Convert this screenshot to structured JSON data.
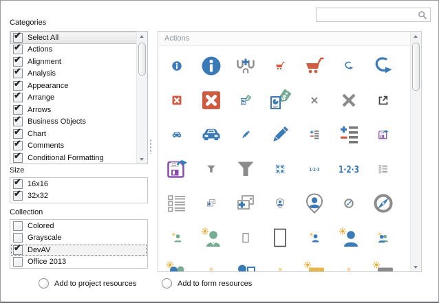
{
  "search": {
    "value": "",
    "placeholder": ""
  },
  "categories": {
    "label": "Categories",
    "items": [
      {
        "label": "Select All",
        "checked": true,
        "selected": true
      },
      {
        "label": "Actions",
        "checked": true
      },
      {
        "label": "Alignment",
        "checked": true
      },
      {
        "label": "Analysis",
        "checked": true
      },
      {
        "label": "Appearance",
        "checked": true
      },
      {
        "label": "Arrange",
        "checked": true
      },
      {
        "label": "Arrows",
        "checked": true
      },
      {
        "label": "Business Objects",
        "checked": true
      },
      {
        "label": "Chart",
        "checked": true
      },
      {
        "label": "Comments",
        "checked": true
      },
      {
        "label": "Conditional Formatting",
        "checked": true
      }
    ]
  },
  "size": {
    "label": "Size",
    "items": [
      {
        "label": "16x16",
        "checked": true
      },
      {
        "label": "32x32",
        "checked": true
      }
    ]
  },
  "collection": {
    "label": "Collection",
    "items": [
      {
        "label": "Colored",
        "checked": false
      },
      {
        "label": "Grayscale",
        "checked": false
      },
      {
        "label": "DevAV",
        "checked": true,
        "focused": true
      },
      {
        "label": "Office 2013",
        "checked": false
      }
    ]
  },
  "icon_panel": {
    "header": "Actions",
    "icons": [
      {
        "name": "info",
        "size": 16
      },
      {
        "name": "info",
        "size": 32
      },
      {
        "name": "insert-between",
        "size": 32
      },
      {
        "name": "shopping-cart",
        "size": 16
      },
      {
        "name": "shopping-cart",
        "size": 32
      },
      {
        "name": "redo-arrow",
        "size": 16
      },
      {
        "name": "redo-arrow",
        "size": 32
      },
      {
        "name": "delete",
        "size": 16
      },
      {
        "name": "delete",
        "size": 32
      },
      {
        "name": "price-tag",
        "size": 16
      },
      {
        "name": "price-tag",
        "size": 32
      },
      {
        "name": "close",
        "size": 16
      },
      {
        "name": "close",
        "size": 32
      },
      {
        "name": "open-external",
        "size": 16
      },
      {
        "name": "car",
        "size": 16
      },
      {
        "name": "car",
        "size": 32
      },
      {
        "name": "edit-pencil",
        "size": 16
      },
      {
        "name": "edit-pencil",
        "size": 32
      },
      {
        "name": "add-remove-items",
        "size": 16
      },
      {
        "name": "add-remove-items",
        "size": 32
      },
      {
        "name": "save-export",
        "size": 16
      },
      {
        "name": "save-export",
        "size": 32
      },
      {
        "name": "filter",
        "size": 16
      },
      {
        "name": "filter",
        "size": 32
      },
      {
        "name": "expand",
        "size": 16
      },
      {
        "name": "numbering",
        "size": 16
      },
      {
        "name": "numbering",
        "size": 32
      },
      {
        "name": "item-list",
        "size": 16
      },
      {
        "name": "item-list",
        "size": 32
      },
      {
        "name": "add-cards",
        "size": 16
      },
      {
        "name": "add-cards",
        "size": 32
      },
      {
        "name": "person-pin",
        "size": 16
      },
      {
        "name": "person-pin",
        "size": 32
      },
      {
        "name": "compass",
        "size": 16
      },
      {
        "name": "compass",
        "size": 32
      },
      {
        "name": "new-employee-green",
        "size": 16
      },
      {
        "name": "new-employee-green",
        "size": 32
      },
      {
        "name": "blank-form",
        "size": 16
      },
      {
        "name": "blank-form",
        "size": 32
      },
      {
        "name": "new-employee-blue",
        "size": 16
      },
      {
        "name": "new-employee-blue",
        "size": 32
      },
      {
        "name": "new-team",
        "size": 16
      },
      {
        "name": "new-team",
        "size": 32
      },
      {
        "name": "sparkle",
        "size": 16
      },
      {
        "name": "id-card-person",
        "size": 32
      },
      {
        "name": "sparkle",
        "size": 16
      },
      {
        "name": "new-badge-yellow",
        "size": 32
      },
      {
        "name": "sparkle",
        "size": 16
      },
      {
        "name": "new-badge-gray",
        "size": 32
      }
    ]
  },
  "footer": {
    "options": [
      {
        "label": "Add to project resources",
        "selected": false
      },
      {
        "label": "Add to form resources",
        "selected": false
      }
    ]
  },
  "colors": {
    "blue": "#3a7ab7",
    "red": "#cf5b40",
    "green": "#76ac92",
    "purple": "#8d4fae",
    "gray": "#8b8b8b",
    "dark": "#3f4042",
    "yellow": "#ecaa31"
  }
}
